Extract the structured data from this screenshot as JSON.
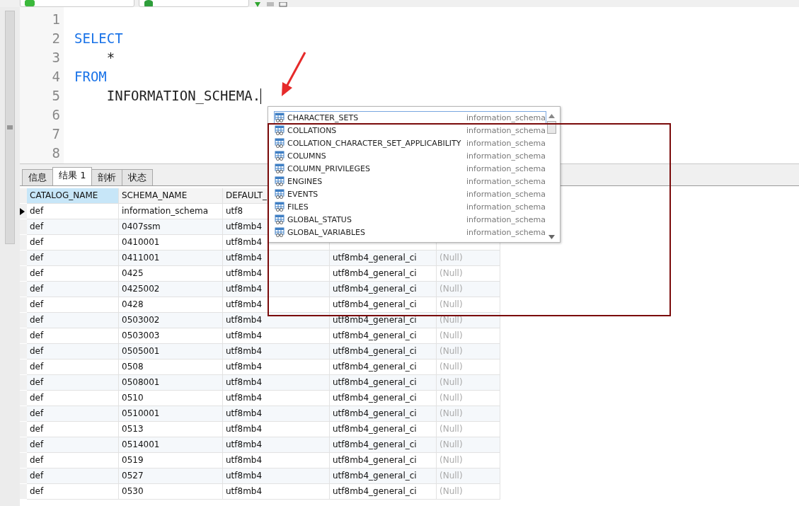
{
  "editor": {
    "lines": [
      {
        "number": "1",
        "cursor": false
      },
      {
        "number": "2",
        "code": "SELECT",
        "kind": "keyword",
        "cursor": false
      },
      {
        "number": "3",
        "code": "    *",
        "kind": "plain",
        "cursor": false
      },
      {
        "number": "4",
        "code": "FROM",
        "kind": "keyword",
        "cursor": false
      },
      {
        "number": "5",
        "code": "    INFORMATION_SCHEMA.",
        "kind": "plain",
        "cursor": true
      },
      {
        "number": "6",
        "cursor": false
      },
      {
        "number": "7",
        "cursor": false
      },
      {
        "number": "8",
        "cursor": false
      }
    ]
  },
  "autocomplete": {
    "items": [
      {
        "name": "CHARACTER_SETS",
        "schema": "information_schema",
        "selected": true
      },
      {
        "name": "COLLATIONS",
        "schema": "information_schema",
        "selected": false
      },
      {
        "name": "COLLATION_CHARACTER_SET_APPLICABILITY",
        "schema": "information_schema",
        "selected": false
      },
      {
        "name": "COLUMNS",
        "schema": "information_schema",
        "selected": false
      },
      {
        "name": "COLUMN_PRIVILEGES",
        "schema": "information_schema",
        "selected": false
      },
      {
        "name": "ENGINES",
        "schema": "information_schema",
        "selected": false
      },
      {
        "name": "EVENTS",
        "schema": "information_schema",
        "selected": false
      },
      {
        "name": "FILES",
        "schema": "information_schema",
        "selected": false
      },
      {
        "name": "GLOBAL_STATUS",
        "schema": "information_schema",
        "selected": false
      },
      {
        "name": "GLOBAL_VARIABLES",
        "schema": "information_schema",
        "selected": false
      }
    ]
  },
  "tabs": [
    {
      "label": "信息",
      "selected": false
    },
    {
      "label": "结果 1",
      "selected": true
    },
    {
      "label": "剖析",
      "selected": false
    },
    {
      "label": "状态",
      "selected": false
    }
  ],
  "table": {
    "columns": [
      {
        "label": "CATALOG_NAME",
        "selected": true
      },
      {
        "label": "SCHEMA_NAME",
        "selected": false
      },
      {
        "label": "DEFAULT_",
        "selected": false
      }
    ],
    "rows": [
      {
        "selected": true,
        "cells": [
          "def",
          "information_schema",
          "utf8"
        ]
      },
      {
        "selected": false,
        "cells": [
          "def",
          "0407ssm",
          "utf8mb4"
        ]
      },
      {
        "selected": false,
        "cells": [
          "def",
          "0410001",
          "utf8mb4"
        ]
      },
      {
        "selected": false,
        "cells": [
          "def",
          "0411001",
          "utf8mb4",
          "utf8mb4_general_ci",
          "(Null)"
        ]
      },
      {
        "selected": false,
        "cells": [
          "def",
          "0425",
          "utf8mb4",
          "utf8mb4_general_ci",
          "(Null)"
        ]
      },
      {
        "selected": false,
        "cells": [
          "def",
          "0425002",
          "utf8mb4",
          "utf8mb4_general_ci",
          "(Null)"
        ]
      },
      {
        "selected": false,
        "cells": [
          "def",
          "0428",
          "utf8mb4",
          "utf8mb4_general_ci",
          "(Null)"
        ]
      },
      {
        "selected": false,
        "cells": [
          "def",
          "0503002",
          "utf8mb4",
          "utf8mb4_general_ci",
          "(Null)"
        ]
      },
      {
        "selected": false,
        "cells": [
          "def",
          "0503003",
          "utf8mb4",
          "utf8mb4_general_ci",
          "(Null)"
        ]
      },
      {
        "selected": false,
        "cells": [
          "def",
          "0505001",
          "utf8mb4",
          "utf8mb4_general_ci",
          "(Null)"
        ]
      },
      {
        "selected": false,
        "cells": [
          "def",
          "0508",
          "utf8mb4",
          "utf8mb4_general_ci",
          "(Null)"
        ]
      },
      {
        "selected": false,
        "cells": [
          "def",
          "0508001",
          "utf8mb4",
          "utf8mb4_general_ci",
          "(Null)"
        ]
      },
      {
        "selected": false,
        "cells": [
          "def",
          "0510",
          "utf8mb4",
          "utf8mb4_general_ci",
          "(Null)"
        ]
      },
      {
        "selected": false,
        "cells": [
          "def",
          "0510001",
          "utf8mb4",
          "utf8mb4_general_ci",
          "(Null)"
        ]
      },
      {
        "selected": false,
        "cells": [
          "def",
          "0513",
          "utf8mb4",
          "utf8mb4_general_ci",
          "(Null)"
        ]
      },
      {
        "selected": false,
        "cells": [
          "def",
          "0514001",
          "utf8mb4",
          "utf8mb4_general_ci",
          "(Null)"
        ]
      },
      {
        "selected": false,
        "cells": [
          "def",
          "0519",
          "utf8mb4",
          "utf8mb4_general_ci",
          "(Null)"
        ]
      },
      {
        "selected": false,
        "cells": [
          "def",
          "0527",
          "utf8mb4",
          "utf8mb4_general_ci",
          "(Null)"
        ]
      },
      {
        "selected": false,
        "cells": [
          "def",
          "0530",
          "utf8mb4",
          "utf8mb4_general_ci",
          "(Null)"
        ]
      }
    ]
  }
}
